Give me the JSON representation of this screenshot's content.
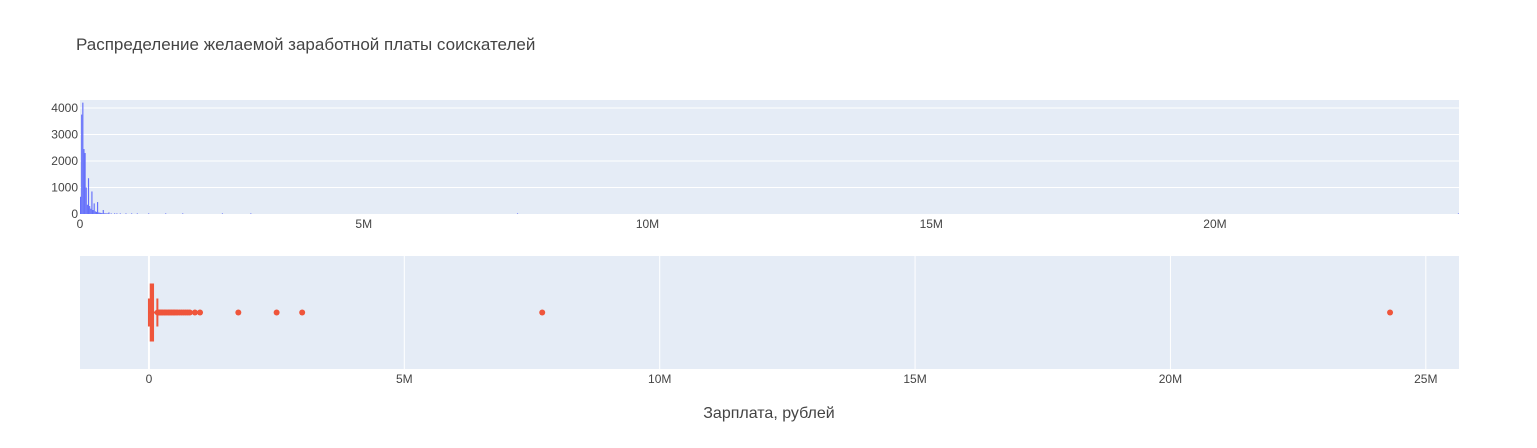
{
  "chart_data": [
    {
      "type": "bar",
      "subtype": "histogram",
      "title": "Распределение желаемой заработной платы соискателей",
      "xlim": [
        0,
        24300000
      ],
      "ylim": [
        0,
        4300
      ],
      "x_ticks": [
        {
          "value": 0,
          "label": "0"
        },
        {
          "value": 5000000,
          "label": "5M"
        },
        {
          "value": 10000000,
          "label": "10M"
        },
        {
          "value": 15000000,
          "label": "15M"
        },
        {
          "value": 20000000,
          "label": "20M"
        }
      ],
      "y_ticks": [
        {
          "value": 0,
          "label": "0"
        },
        {
          "value": 1000,
          "label": "1000"
        },
        {
          "value": 2000,
          "label": "2000"
        },
        {
          "value": 3000,
          "label": "3000"
        },
        {
          "value": 4000,
          "label": "4000"
        }
      ],
      "color": "#636efa",
      "bin_width": 20000,
      "bins": [
        {
          "x": 10000,
          "y": 650
        },
        {
          "x": 30000,
          "y": 3750
        },
        {
          "x": 50000,
          "y": 4200
        },
        {
          "x": 70000,
          "y": 2450
        },
        {
          "x": 90000,
          "y": 2300
        },
        {
          "x": 110000,
          "y": 1000
        },
        {
          "x": 130000,
          "y": 350
        },
        {
          "x": 150000,
          "y": 1350
        },
        {
          "x": 170000,
          "y": 300
        },
        {
          "x": 190000,
          "y": 200
        },
        {
          "x": 210000,
          "y": 850
        },
        {
          "x": 230000,
          "y": 150
        },
        {
          "x": 250000,
          "y": 400
        },
        {
          "x": 270000,
          "y": 100
        },
        {
          "x": 290000,
          "y": 80
        },
        {
          "x": 310000,
          "y": 450
        },
        {
          "x": 330000,
          "y": 60
        },
        {
          "x": 350000,
          "y": 50
        },
        {
          "x": 370000,
          "y": 40
        },
        {
          "x": 390000,
          "y": 30
        },
        {
          "x": 410000,
          "y": 150
        },
        {
          "x": 430000,
          "y": 25
        },
        {
          "x": 450000,
          "y": 20
        },
        {
          "x": 470000,
          "y": 18
        },
        {
          "x": 490000,
          "y": 15
        },
        {
          "x": 510000,
          "y": 60
        },
        {
          "x": 550000,
          "y": 12
        },
        {
          "x": 610000,
          "y": 25
        },
        {
          "x": 650000,
          "y": 8
        },
        {
          "x": 710000,
          "y": 10
        },
        {
          "x": 810000,
          "y": 8
        },
        {
          "x": 910000,
          "y": 6
        },
        {
          "x": 1010000,
          "y": 10
        },
        {
          "x": 1210000,
          "y": 4
        },
        {
          "x": 1510000,
          "y": 5
        },
        {
          "x": 1810000,
          "y": 3
        },
        {
          "x": 2510000,
          "y": 3
        },
        {
          "x": 3010000,
          "y": 3
        },
        {
          "x": 7710000,
          "y": 3
        },
        {
          "x": 24290000,
          "y": 3
        }
      ]
    },
    {
      "type": "box",
      "orientation": "horizontal",
      "xlabel": "Зарплата, рублей",
      "xlim": [
        -1350000,
        25650000
      ],
      "x_ticks": [
        {
          "value": 0,
          "label": "0"
        },
        {
          "value": 5000000,
          "label": "5M"
        },
        {
          "value": 10000000,
          "label": "10M"
        },
        {
          "value": 15000000,
          "label": "15M"
        },
        {
          "value": 20000000,
          "label": "20M"
        },
        {
          "value": 25000000,
          "label": "25M"
        }
      ],
      "color": "#ef553b",
      "stats": {
        "min": 0,
        "lowerfence": 0,
        "q1": 35000,
        "median": 50000,
        "q3": 80000,
        "upperfence": 165000
      },
      "outliers": [
        170000,
        190000,
        210000,
        230000,
        250000,
        270000,
        300000,
        320000,
        350000,
        380000,
        400000,
        430000,
        450000,
        480000,
        500000,
        530000,
        560000,
        600000,
        640000,
        680000,
        720000,
        760000,
        800000,
        900000,
        1000000,
        1750000,
        2500000,
        3000000,
        7700000,
        24300000
      ]
    }
  ]
}
